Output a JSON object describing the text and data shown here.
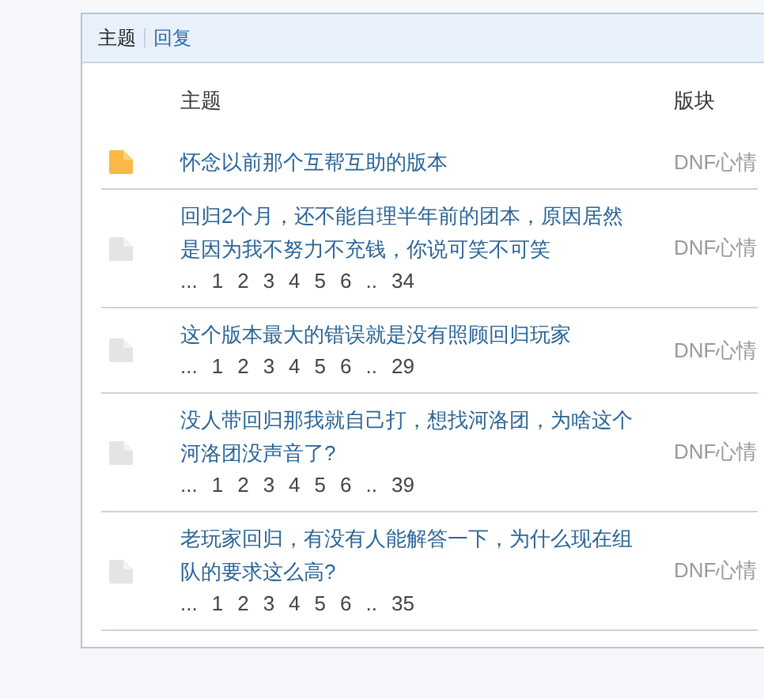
{
  "tabs": [
    {
      "label": "主题",
      "selected": true
    },
    {
      "label": "回复",
      "selected": false
    }
  ],
  "columns": {
    "title": "主题",
    "forum": "版块"
  },
  "rows": [
    {
      "kind": "hot",
      "title": "怀念以前那个互帮互助的版本",
      "pages": [],
      "forum": "DNF心情"
    },
    {
      "kind": "normal",
      "title": "回归2个月，还不能自理半年前的团本，原因居然是因为我不努力不充钱，你说可笑不可笑",
      "pages": [
        "...",
        "1",
        "2",
        "3",
        "4",
        "5",
        "6",
        "..",
        "34"
      ],
      "forum": "DNF心情"
    },
    {
      "kind": "normal",
      "title": "这个版本最大的错误就是没有照顾回归玩家",
      "pages": [
        "...",
        "1",
        "2",
        "3",
        "4",
        "5",
        "6",
        "..",
        "29"
      ],
      "forum": "DNF心情"
    },
    {
      "kind": "normal",
      "title": "没人带回归那我就自己打，想找河洛团，为啥这个河洛团没声音了?",
      "pages": [
        "...",
        "1",
        "2",
        "3",
        "4",
        "5",
        "6",
        "..",
        "39"
      ],
      "forum": "DNF心情"
    },
    {
      "kind": "normal",
      "title": "老玩家回归，有没有人能解答一下，为什么现在组队的要求这么高?",
      "pages": [
        "...",
        "1",
        "2",
        "3",
        "4",
        "5",
        "6",
        "..",
        "35"
      ],
      "forum": "DNF心情"
    }
  ]
}
